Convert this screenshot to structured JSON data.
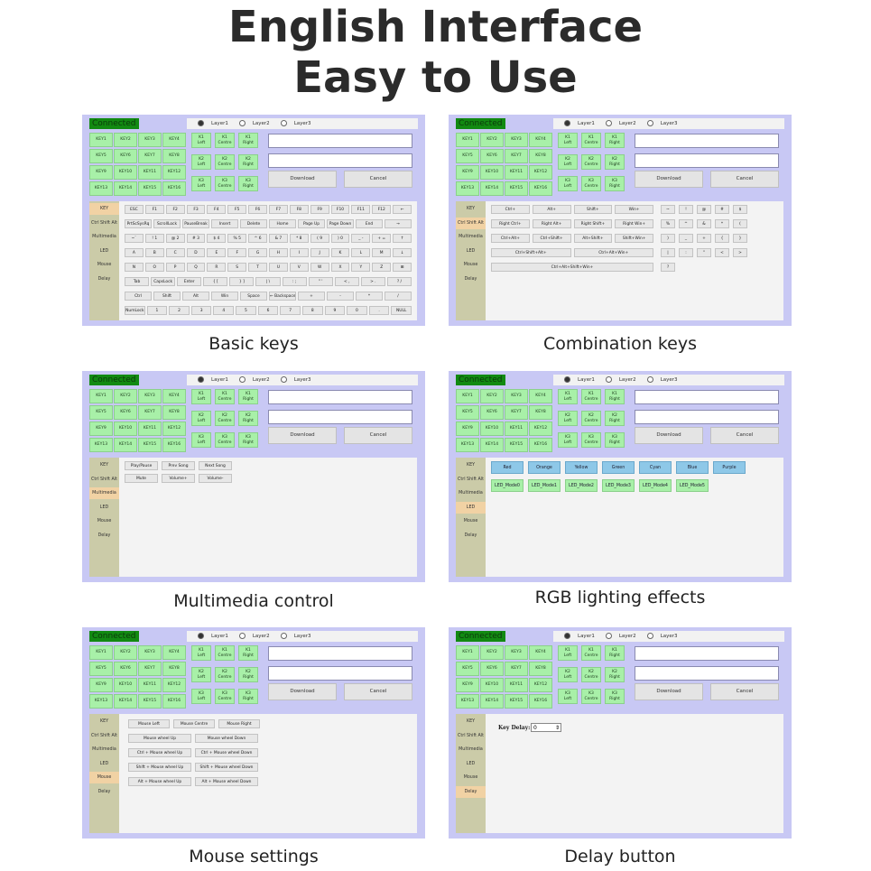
{
  "headline": [
    "English Interface",
    "Easy to Use"
  ],
  "common": {
    "connected": "Connected",
    "layers": [
      "Layer1",
      "Layer2",
      "Layer3"
    ],
    "keys": [
      "KEY1",
      "KEY2",
      "KEY3",
      "KEY4",
      "KEY5",
      "KEY6",
      "KEY7",
      "KEY8",
      "KEY9",
      "KEY10",
      "KEY11",
      "KEY12",
      "KEY13",
      "KEY14",
      "KEY15",
      "KEY16"
    ],
    "knobs": [
      [
        "K1",
        "Left"
      ],
      [
        "K1",
        "Centre"
      ],
      [
        "K1",
        "Right"
      ],
      [
        "K2",
        "Left"
      ],
      [
        "K2",
        "Centre"
      ],
      [
        "K2",
        "Right"
      ],
      [
        "K3",
        "Left"
      ],
      [
        "K3",
        "Centre"
      ],
      [
        "K3",
        "Right"
      ]
    ],
    "download": "Download",
    "cancel": "Cancel",
    "sidebar": [
      "KEY",
      "Ctrl Shift Alt",
      "Multimedia",
      "LED",
      "Mouse",
      "Delay"
    ]
  },
  "panels": [
    {
      "caption": "Basic keys",
      "active": 0
    },
    {
      "caption": "Combination keys",
      "active": 1
    },
    {
      "caption": "Multimedia control",
      "active": 2
    },
    {
      "caption": "RGB lighting effects",
      "active": 3
    },
    {
      "caption": "Mouse settings",
      "active": 4
    },
    {
      "caption": "Delay button",
      "active": 5
    }
  ],
  "basic_keys": [
    [
      "ESC",
      "F1",
      "F2",
      "F3",
      "F4",
      "F5",
      "F6",
      "F7",
      "F8",
      "F9",
      "F10",
      "F11",
      "F12",
      "←"
    ],
    [
      "PrtScSysRq",
      "ScrollLock",
      "PauseBreak",
      "Insert",
      "Delete",
      "Home",
      "Page Up",
      "Page Down",
      "End",
      "→"
    ],
    [
      "~`",
      "! 1",
      "@ 2",
      "# 3",
      "$ 4",
      "% 5",
      "^ 6",
      "& 7",
      "* 8",
      "( 9",
      ") 0",
      "_ -",
      "+ =",
      "↑"
    ],
    [
      "A",
      "B",
      "C",
      "D",
      "E",
      "F",
      "G",
      "H",
      "I",
      "J",
      "K",
      "L",
      "M",
      "↓"
    ],
    [
      "N",
      "O",
      "P",
      "Q",
      "R",
      "S",
      "T",
      "U",
      "V",
      "W",
      "X",
      "Y",
      "Z",
      "⊞"
    ],
    [
      "Tab",
      "CapsLock",
      "Enter",
      "{ [",
      "} ]",
      "| \\",
      ": ;",
      "\" '",
      "< ,",
      "> .",
      "? /"
    ],
    [
      "Ctrl",
      "Shift",
      "Alt",
      "Win",
      "Space",
      "← Backspace",
      "+",
      "-",
      "*",
      "/"
    ],
    [
      "NumLock",
      "1",
      "2",
      "3",
      "4",
      "5",
      "6",
      "7",
      "8",
      "9",
      "0",
      ".",
      "NULL"
    ]
  ],
  "combo": {
    "rows": [
      [
        "Ctrl+",
        "Alt+",
        "Shift+",
        "Win+"
      ],
      [
        "Right Ctrl+",
        "Right Alt+",
        "Right Shift+",
        "Right Win+"
      ],
      [
        "Ctrl+Alt+",
        "Ctrl+Shift+",
        "Alt+Shift+",
        "Shift+Win+"
      ],
      [
        "Ctrl+Shift+Alt+",
        "Ctrl+Alt+Win+"
      ],
      [
        "Ctrl+Alt+Shift+Win+"
      ]
    ],
    "symbols": [
      [
        "~",
        "!",
        "@",
        "#",
        "$"
      ],
      [
        "%",
        "^",
        "&",
        "*",
        "("
      ],
      [
        ")",
        "_",
        "+",
        "{",
        "}"
      ],
      [
        "|",
        ":",
        "\"",
        "<",
        ">"
      ],
      [
        "?"
      ]
    ]
  },
  "multimedia": [
    [
      "Play/Pause",
      "Prev Song",
      "Next Song"
    ],
    [
      "Mute",
      "Volume+",
      "Volume-"
    ]
  ],
  "rgb": {
    "colors": [
      "Red",
      "Orange",
      "Yellow",
      "Green",
      "Cyan",
      "Blue",
      "Purple"
    ],
    "modes": [
      "LED_Mode0",
      "LED_Mode1",
      "LED_Mode2",
      "LED_Mode3",
      "LED_Mode4",
      "LED_Mode5"
    ],
    "color_btn_bg": "#8ec8e8",
    "mode_btn_bg": "#a8f0a8"
  },
  "mouse": [
    [
      "Mouse Left",
      "Mouse Centre",
      "Mouse Right"
    ],
    [
      "Mouse wheel Up",
      "Mouse wheel Down"
    ],
    [
      "Ctrl + Mouse wheel Up",
      "Ctrl + Mouse wheel Down"
    ],
    [
      "Shift + Mouse wheel Up",
      "Shift + Mouse wheel Down"
    ],
    [
      "Alt + Mouse wheel Up",
      "Alt + Mouse wheel Down"
    ]
  ],
  "delay": {
    "label": "Key Delay:",
    "value": "0"
  }
}
